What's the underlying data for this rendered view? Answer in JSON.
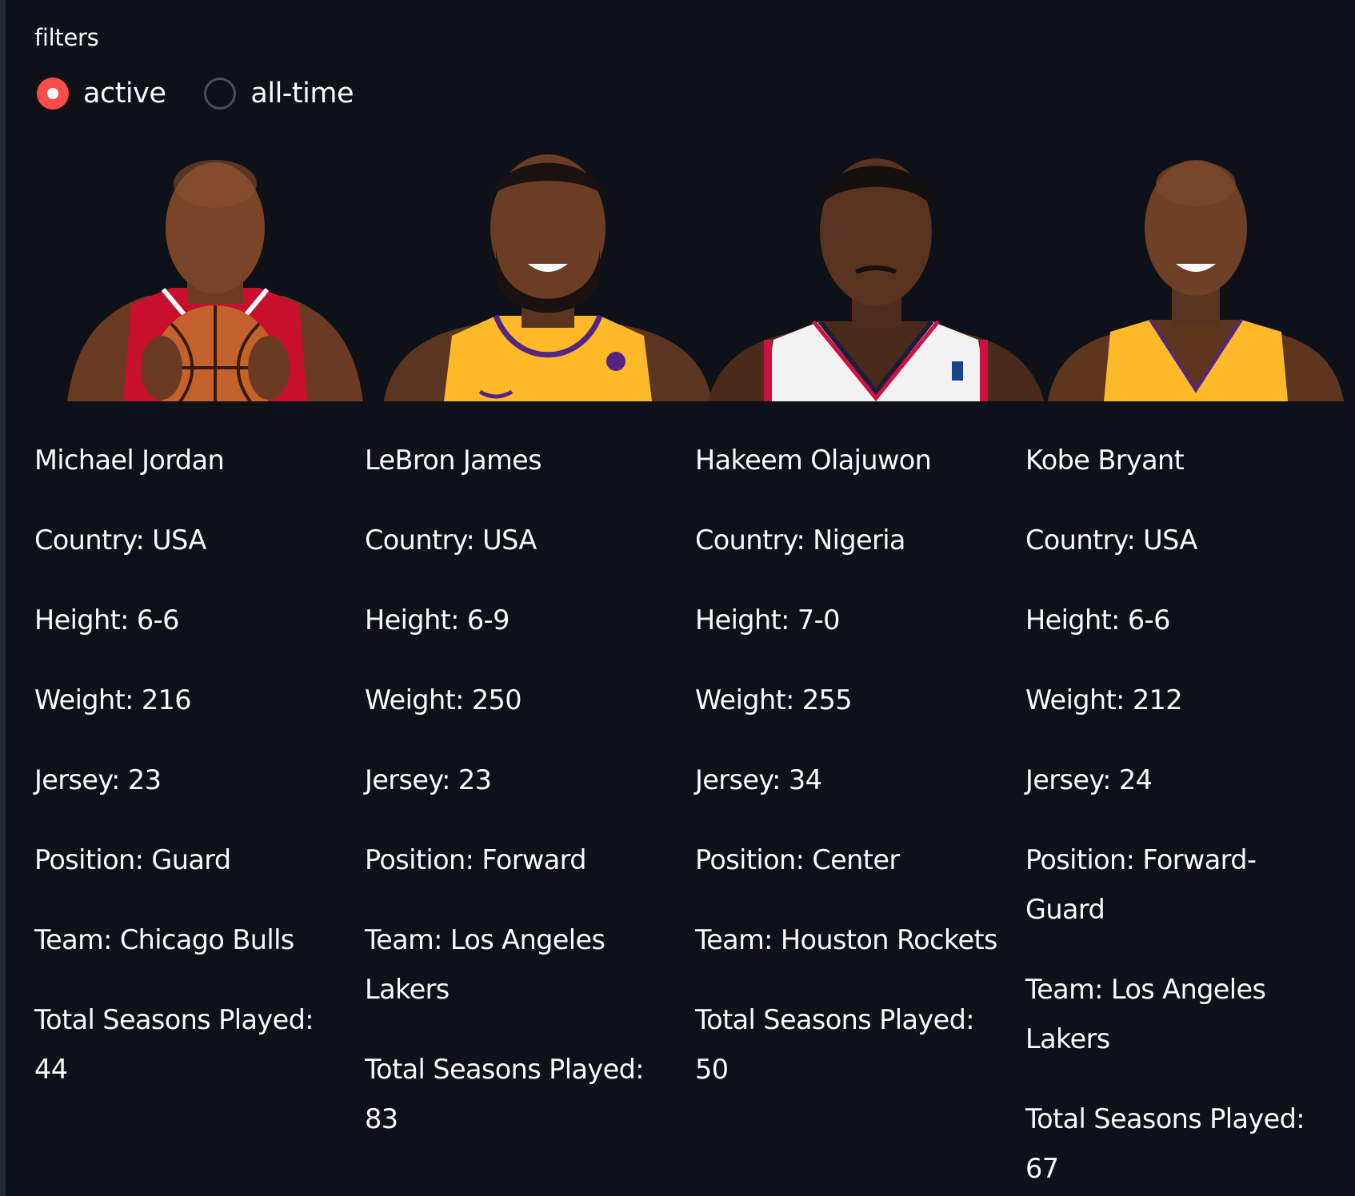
{
  "filters": {
    "label": "filters",
    "options": [
      {
        "label": "active",
        "selected": true
      },
      {
        "label": "all-time",
        "selected": false
      }
    ]
  },
  "players": [
    {
      "name": "Michael Jordan",
      "country": "Country: USA",
      "height": "Height: 6-6",
      "weight": "Weight: 216",
      "jersey": "Jersey: 23",
      "position": "Position: Guard",
      "team": "Team: Chicago Bulls",
      "seasons": "Total Seasons Played: 44",
      "jersey_color": "#c8102e"
    },
    {
      "name": "LeBron James",
      "country": "Country: USA",
      "height": "Height: 6-9",
      "weight": "Weight: 250",
      "jersey": "Jersey: 23",
      "position": "Position: Forward",
      "team": "Team: Los Angeles Lakers",
      "seasons": "Total Seasons Played: 83",
      "jersey_color": "#fdb927"
    },
    {
      "name": "Hakeem Olajuwon",
      "country": "Country: Nigeria",
      "height": "Height: 7-0",
      "weight": "Weight: 255",
      "jersey": "Jersey: 34",
      "position": "Position: Center",
      "team": "Team: Houston Rockets",
      "seasons": "Total Seasons Played: 50",
      "jersey_color": "#f2f2f2"
    },
    {
      "name": "Kobe Bryant",
      "country": "Country: USA",
      "height": "Height: 6-6",
      "weight": "Weight: 212",
      "jersey": "Jersey: 24",
      "position": "Position: Forward-Guard",
      "team": "Team: Los Angeles Lakers",
      "seasons": "Total Seasons Played: 67",
      "jersey_color": "#fdb927"
    }
  ],
  "theme": {
    "background": "#0e1117",
    "text": "#fafafa",
    "accent": "#ff4b4b"
  }
}
